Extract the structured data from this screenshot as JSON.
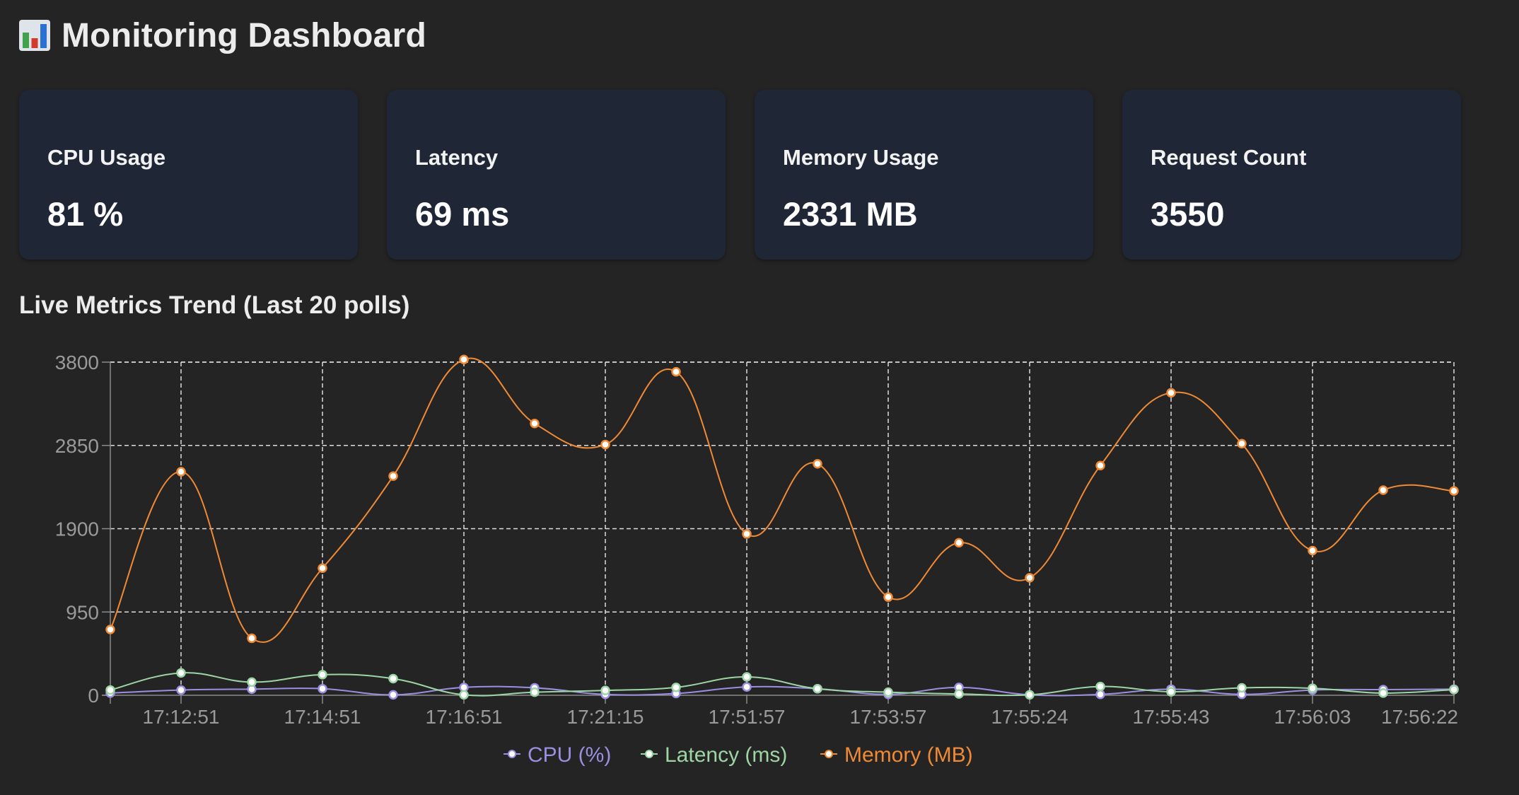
{
  "header": {
    "title": "Monitoring Dashboard",
    "icon": "bar-chart-icon"
  },
  "cards": [
    {
      "label": "CPU Usage",
      "value": "81 %"
    },
    {
      "label": "Latency",
      "value": "69 ms"
    },
    {
      "label": "Memory Usage",
      "value": "2331 MB"
    },
    {
      "label": "Request Count",
      "value": "3550"
    }
  ],
  "section": {
    "title": "Live Metrics Trend (Last 20 polls)"
  },
  "colors": {
    "background": "#242424",
    "card": "#1f2635",
    "cpu": "#9a8fe0",
    "latency": "#9dd6a4",
    "memory": "#f08a35",
    "grid": "#dcdcdc",
    "axis_text": "#9a9a9a"
  },
  "chart_data": {
    "type": "line",
    "title": "",
    "xlabel": "",
    "ylabel": "",
    "ylim": [
      0,
      3800
    ],
    "yticks": [
      "3800",
      "2850",
      "1900",
      "950",
      "0"
    ],
    "x_tick_labels": [
      "17:12:51",
      "17:14:51",
      "17:16:51",
      "17:21:15",
      "17:51:57",
      "17:53:57",
      "17:55:24",
      "17:55:43",
      "17:56:03",
      "17:56:22"
    ],
    "num_points": 20,
    "grid": true,
    "legend_position": "bottom",
    "series": [
      {
        "name": "CPU (%)",
        "values": [
          25,
          60,
          70,
          75,
          5,
          90,
          85,
          10,
          20,
          95,
          75,
          10,
          90,
          5,
          10,
          70,
          10,
          60,
          65,
          70
        ]
      },
      {
        "name": "Latency (ms)",
        "values": [
          60,
          255,
          150,
          235,
          190,
          5,
          35,
          55,
          90,
          210,
          75,
          35,
          15,
          5,
          100,
          40,
          85,
          80,
          25,
          65
        ]
      },
      {
        "name": "Memory (MB)",
        "values": [
          750,
          2550,
          650,
          1450,
          2500,
          3830,
          3100,
          2860,
          3690,
          1840,
          2640,
          1120,
          1740,
          1340,
          2620,
          3450,
          2870,
          1650,
          2340,
          2331
        ]
      }
    ]
  }
}
